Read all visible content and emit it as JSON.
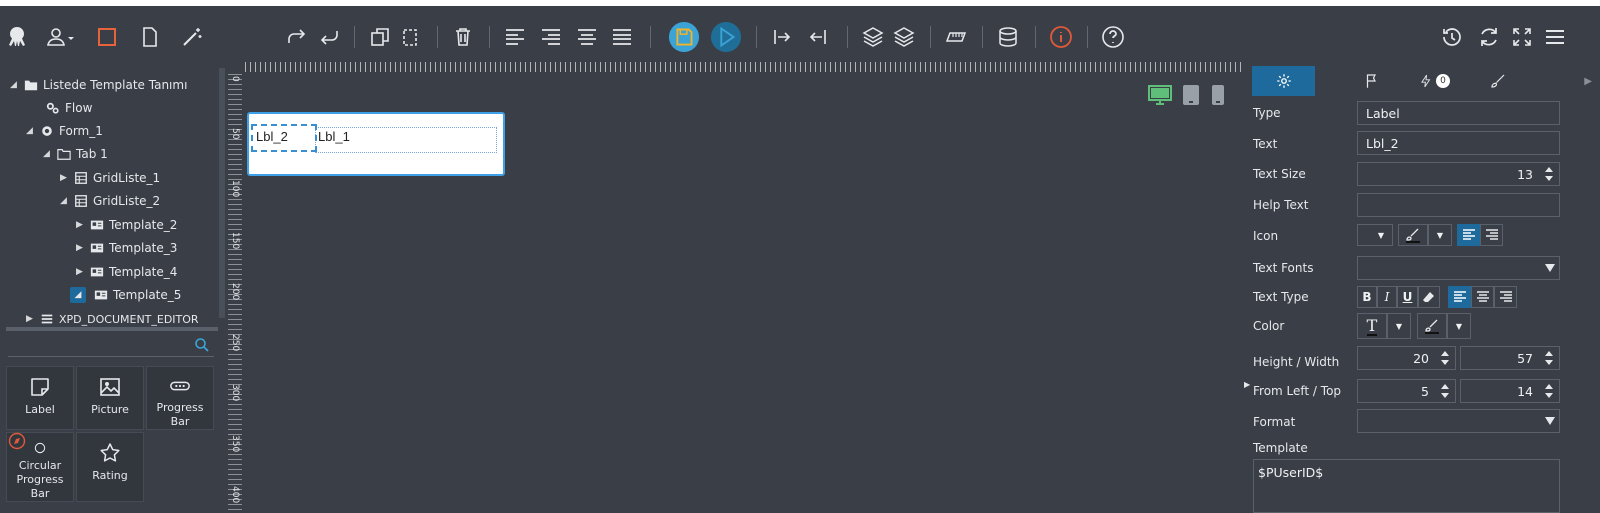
{
  "toolbar": {
    "left_icons": [
      "octopus-logo-icon",
      "user-icon",
      "square-icon",
      "file-icon",
      "magic-wand-icon"
    ],
    "middle_icons": [
      "redo-icon",
      "undo-icon",
      "copy-icon",
      "paste-icon",
      "delete-icon",
      "align-left-icon",
      "align-right-icon",
      "align-center-icon",
      "align-justify-icon",
      "save-icon",
      "run-icon",
      "indent-right-icon",
      "indent-left-icon",
      "layers-up-icon",
      "layers-down-icon",
      "ruler-icon",
      "database-icon",
      "info-icon",
      "help-icon"
    ],
    "right_icons": [
      "history-icon",
      "refresh-icon",
      "fullscreen-icon",
      "menu-icon"
    ],
    "accent_save": "#f0b429",
    "accent_run": "#3ca3d6",
    "accent_info": "#e0593a"
  },
  "tree": {
    "root_label": "Listede Template Tanımı",
    "items": [
      {
        "label": "Flow"
      },
      {
        "label": "Form_1"
      },
      {
        "label": "Tab 1"
      },
      {
        "label": "GridListe_1"
      },
      {
        "label": "GridListe_2"
      },
      {
        "label": "Template_2"
      },
      {
        "label": "Template_3"
      },
      {
        "label": "Template_4"
      },
      {
        "label": "Template_5"
      },
      {
        "label": "XPD_DOCUMENT_EDITOR"
      }
    ]
  },
  "search": {
    "placeholder": ""
  },
  "components": [
    {
      "label": "Label"
    },
    {
      "label": "Picture"
    },
    {
      "label": "Progress Bar"
    },
    {
      "label": "Circular Progress Bar"
    },
    {
      "label": "Rating"
    }
  ],
  "ruler": {
    "left_marks": [
      "0",
      "50",
      "100",
      "150",
      "200",
      "250",
      "300",
      "350",
      "400"
    ]
  },
  "canvas": {
    "labels": {
      "lbl2": "Lbl_2",
      "lbl1": "Lbl_1"
    }
  },
  "panel": {
    "tabs": [
      {
        "icon": "settings-icon"
      },
      {
        "icon": "flag-icon"
      },
      {
        "icon": "bolt-icon",
        "badge": "0"
      },
      {
        "icon": "brush-icon"
      }
    ],
    "type": {
      "label": "Type",
      "value": "Label"
    },
    "text": {
      "label": "Text",
      "value": "Lbl_2"
    },
    "text_size": {
      "label": "Text Size",
      "value": "13"
    },
    "help_text": {
      "label": "Help Text",
      "value": ""
    },
    "icon": {
      "label": "Icon"
    },
    "text_fonts": {
      "label": "Text Fonts",
      "value": ""
    },
    "text_type": {
      "label": "Text Type",
      "bold": "B",
      "italic": "I",
      "underline": "U"
    },
    "color": {
      "label": "Color",
      "text_glyph": "T"
    },
    "height_width": {
      "label": "Height / Width",
      "height": "20",
      "width": "57"
    },
    "from_left_top": {
      "label": "From Left / Top",
      "left": "5",
      "top": "14"
    },
    "format": {
      "label": "Format",
      "value": ""
    },
    "template": {
      "label": "Template",
      "value": "$PUserID$"
    }
  }
}
